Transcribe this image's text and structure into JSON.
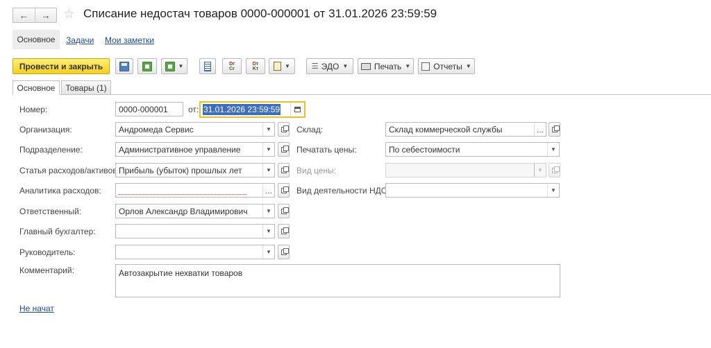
{
  "window": {
    "title": "Списание недостач товаров 0000-000001 от 31.01.2026 23:59:59",
    "back_icon": "←",
    "forward_icon": "→",
    "star_icon": "☆"
  },
  "nav": {
    "tabs": [
      {
        "label": "Основное"
      },
      {
        "label": "Задачи"
      },
      {
        "label": "Мои заметки"
      }
    ]
  },
  "toolbar": {
    "post_and_close": "Провести и закрыть",
    "edo": "ЭДО",
    "print": "Печать",
    "reports": "Отчеты",
    "dt_kt": {
      "top": "Dт",
      "bottom": "Kт"
    },
    "dr_cr": {
      "top": "Dr",
      "bottom": "Cr"
    },
    "caret": "▼"
  },
  "form_tabs": [
    {
      "label": "Основное"
    },
    {
      "label": "Товары (1)"
    }
  ],
  "form": {
    "number_label": "Номер:",
    "number_value": "0000-000001",
    "date_label": "от:",
    "date_value": "31.01.2026 23:59:59",
    "organization_label": "Организация:",
    "organization_value": "Андромеда Сервис",
    "department_label": "Подразделение:",
    "department_value": "Административное управление",
    "expense_item_label": "Статья расходов/активов:",
    "expense_item_value": "Прибыль (убыток) прошлых лет",
    "expense_analytics_label": "Аналитика расходов:",
    "expense_analytics_value": "",
    "responsible_label": "Ответственный:",
    "responsible_value": "Орлов Александр Владимирович",
    "chief_accountant_label": "Главный бухгалтер:",
    "chief_accountant_value": "",
    "manager_label": "Руководитель:",
    "manager_value": "",
    "warehouse_label": "Склад:",
    "warehouse_value": "Склад коммерческой службы",
    "print_prices_label": "Печатать цены:",
    "print_prices_value": "По себестоимости",
    "price_type_label": "Вид цены:",
    "price_type_value": "",
    "vat_activity_label": "Вид деятельности НДС:",
    "vat_activity_value": "",
    "comment_label": "Комментарий:",
    "comment_value": "Автозакрытие нехватки товаров",
    "status_link": "Не начат",
    "dropdown_glyph": "▼",
    "dots_glyph": "..."
  },
  "colors": {
    "primary_button": "#f4cf1c",
    "focus_border": "#f0c020",
    "link": "#1a4aa0",
    "selection": "#3c6ec0"
  }
}
